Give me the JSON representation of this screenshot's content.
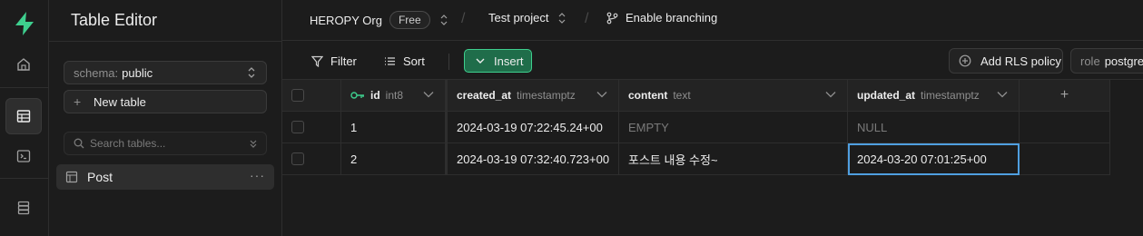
{
  "app": {
    "logo": "supabase-bolt-logo"
  },
  "rail": {
    "icons": [
      "home-icon",
      "table-icon",
      "terminal-icon",
      "database-icon"
    ]
  },
  "sidebar": {
    "title": "Table Editor",
    "schema_label": "schema:",
    "schema_value": "public",
    "new_table": "New table",
    "search_placeholder": "Search tables...",
    "tables": [
      {
        "name": "Post"
      }
    ]
  },
  "topbar": {
    "org": "HEROPY Org",
    "plan": "Free",
    "project": "Test project",
    "branching": "Enable branching"
  },
  "toolbar": {
    "filter": "Filter",
    "sort": "Sort",
    "insert": "Insert",
    "rls": "Add RLS policy",
    "role_label": "role",
    "role_value": "postgres"
  },
  "columns": [
    {
      "name": "id",
      "type": "int8"
    },
    {
      "name": "created_at",
      "type": "timestamptz"
    },
    {
      "name": "content",
      "type": "text"
    },
    {
      "name": "updated_at",
      "type": "timestamptz"
    }
  ],
  "rows": [
    {
      "id": "1",
      "created_at": "2024-03-19 07:22:45.24+00",
      "content": "EMPTY",
      "updated_at": "NULL"
    },
    {
      "id": "2",
      "created_at": "2024-03-19 07:32:40.723+00",
      "content": "포스트 내용 수정~",
      "updated_at": "2024-03-20 07:01:25+00"
    }
  ],
  "colors": {
    "accent": "#3ecf8e",
    "insert_bg": "#1f6d4a",
    "selection": "#4f9fe0"
  }
}
